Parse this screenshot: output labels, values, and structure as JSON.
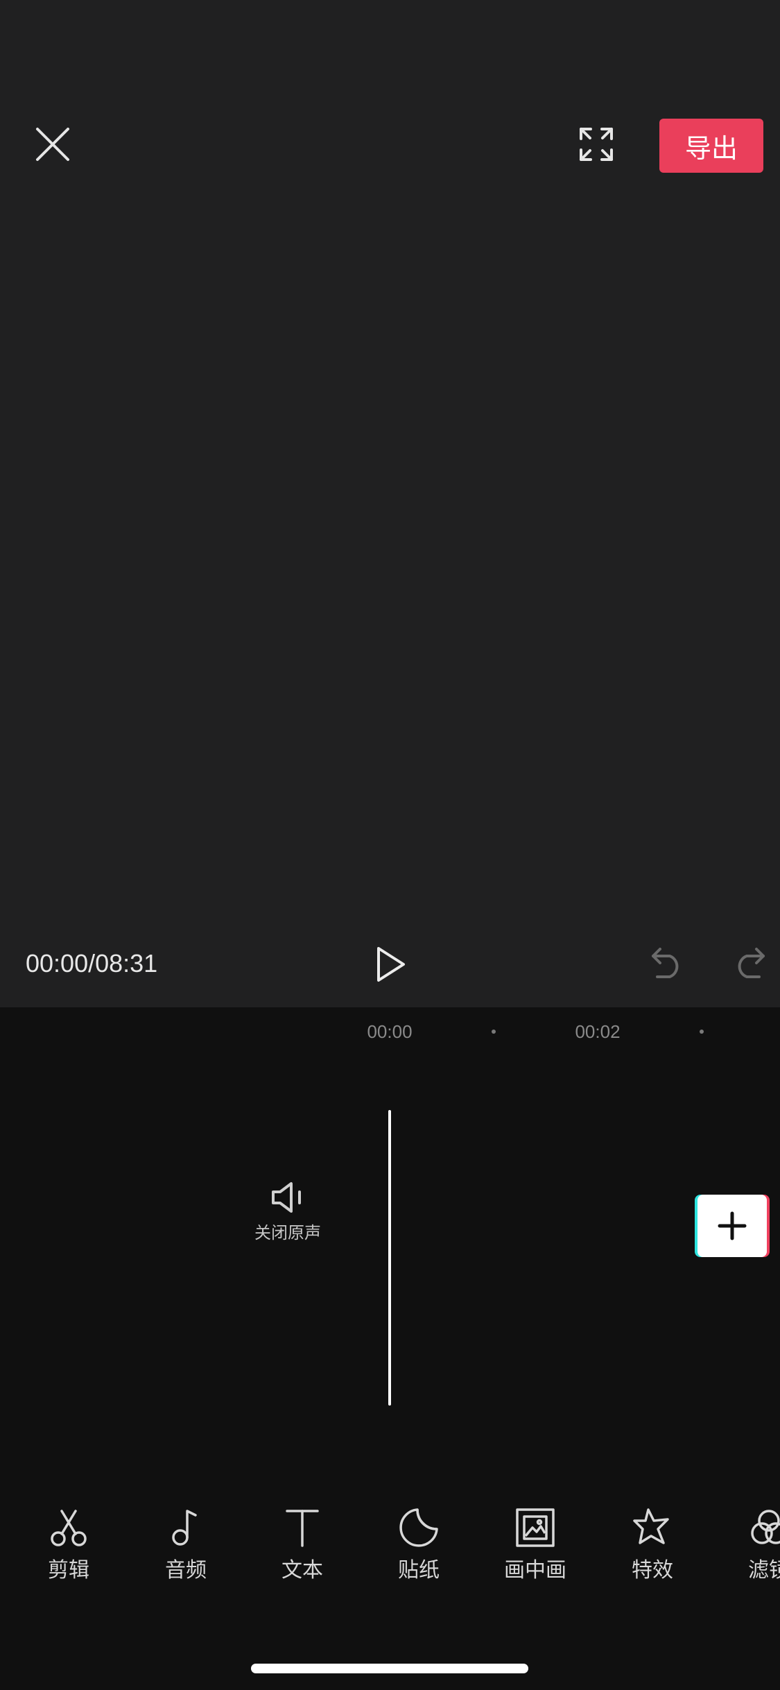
{
  "header": {
    "export_label": "导出"
  },
  "player": {
    "timecode": "00:00/08:31"
  },
  "ruler": {
    "labels": [
      "00:00",
      "00:02"
    ]
  },
  "track": {
    "mute_label": "关闭原声"
  },
  "toolbar": {
    "items": [
      {
        "label": "剪辑",
        "icon": "scissors-icon"
      },
      {
        "label": "音频",
        "icon": "music-note-icon"
      },
      {
        "label": "文本",
        "icon": "text-icon"
      },
      {
        "label": "贴纸",
        "icon": "sticker-icon"
      },
      {
        "label": "画中画",
        "icon": "picture-in-picture-icon"
      },
      {
        "label": "特效",
        "icon": "star-effects-icon"
      },
      {
        "label": "滤镜",
        "icon": "filter-icon"
      }
    ]
  },
  "colors": {
    "accent": "#ea3f5b",
    "preview_bg": "#202021",
    "timeline_bg": "#101010"
  }
}
